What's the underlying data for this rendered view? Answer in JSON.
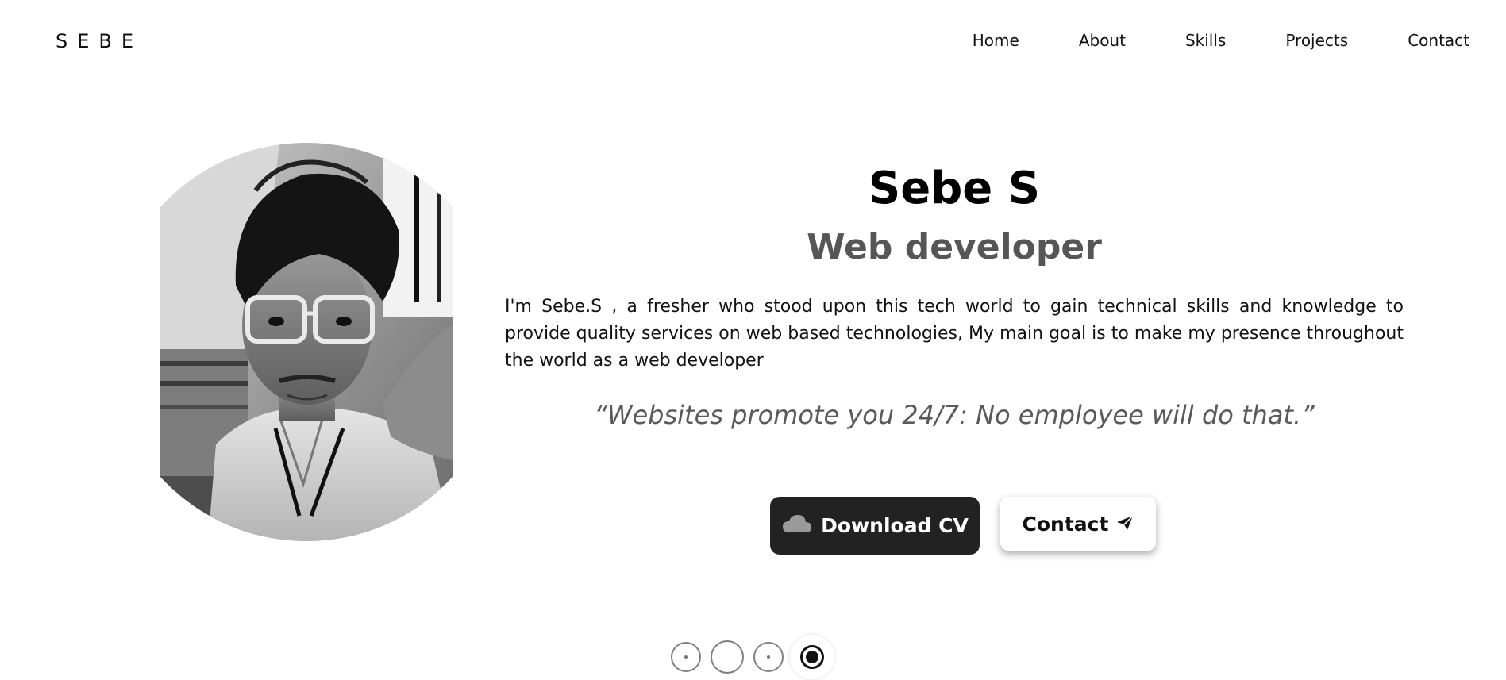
{
  "brand": "SEBE",
  "nav": {
    "items": [
      "Home",
      "About",
      "Skills",
      "Projects",
      "Contact"
    ]
  },
  "hero": {
    "name": "Sebe S",
    "role": "Web developer",
    "bio": "I'm Sebe.S , a fresher who stood upon this tech world to gain technical skills and knowledge to provide quality services on web based technologies, My main goal is to make my presence throughout the world as a web developer",
    "quote": "“Websites promote you 24/7: No employee will do that.”"
  },
  "buttons": {
    "download_cv": "Download CV",
    "contact": "Contact"
  },
  "icons": {
    "download": "cloud-icon",
    "contact": "paper-plane-icon"
  },
  "pagination": {
    "count": 4,
    "active_index": 3
  },
  "colors": {
    "primary_button_bg": "#222222",
    "role_text": "#575656",
    "quote_text": "#5a5a5a"
  }
}
